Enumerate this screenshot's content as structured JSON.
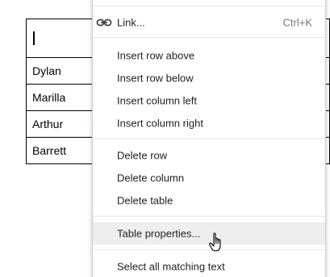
{
  "table": {
    "header_cell": "",
    "rows": [
      "Dylan",
      "Marilla",
      "Arthur",
      "Barrett"
    ]
  },
  "context_menu": {
    "link_item": {
      "label": "Link...",
      "shortcut": "Ctrl+K",
      "icon": "link-icon"
    },
    "insert_group": [
      "Insert row above",
      "Insert row below",
      "Insert column left",
      "Insert column right"
    ],
    "delete_group": [
      "Delete row",
      "Delete column",
      "Delete table"
    ],
    "table_properties": "Table properties...",
    "select_matching": "Select all matching text",
    "highlighted_item": "Table properties..."
  },
  "cursor": {
    "icon": "hand-pointer-icon"
  },
  "colors": {
    "menu_background": "#ffffff",
    "menu_border": "#cccccc",
    "highlight_background": "#eeeeee",
    "text": "#222222",
    "shortcut_text": "#777777"
  }
}
